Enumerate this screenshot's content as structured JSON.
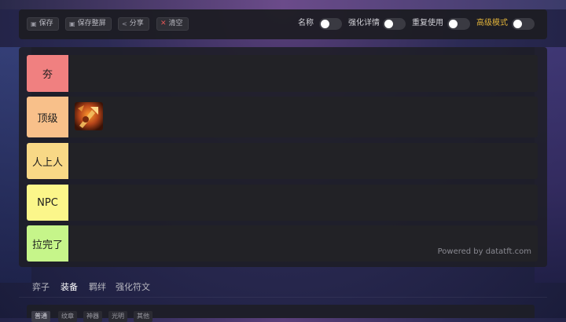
{
  "toolbar": {
    "buttons": [
      {
        "label": "保存",
        "icon": "save-icon"
      },
      {
        "label": "保存整屏",
        "icon": "camera-icon"
      },
      {
        "label": "分享",
        "icon": "share-icon"
      },
      {
        "label": "清空",
        "icon": "clear-icon"
      }
    ],
    "toggles": [
      {
        "label": "名称",
        "on": false
      },
      {
        "label": "强化详情",
        "on": false
      },
      {
        "label": "重复使用",
        "on": false
      },
      {
        "label": "高级模式",
        "on": false,
        "color": "#e0b23a"
      }
    ]
  },
  "tiers": [
    {
      "label": "夯",
      "color": "#f08080",
      "items": []
    },
    {
      "label": "顶级",
      "color": "#f8c08a",
      "items": [
        {
          "name": "item-icon"
        }
      ]
    },
    {
      "label": "人上人",
      "color": "#f8d886",
      "items": []
    },
    {
      "label": "NPC",
      "color": "#fbf68a",
      "items": []
    },
    {
      "label": "拉完了",
      "color": "#c6f58a",
      "items": []
    }
  ],
  "powered_by": "Powered by datatft.com",
  "tabs": [
    {
      "label": "弈子",
      "active": false
    },
    {
      "label": "装备",
      "active": true
    },
    {
      "label": "羁绊",
      "active": false
    },
    {
      "label": "强化符文",
      "active": false
    }
  ],
  "subtabs": [
    {
      "label": "普通",
      "active": true
    },
    {
      "label": "纹章",
      "active": false
    },
    {
      "label": "神器",
      "active": false
    },
    {
      "label": "光明",
      "active": false
    },
    {
      "label": "其他",
      "active": false
    }
  ]
}
